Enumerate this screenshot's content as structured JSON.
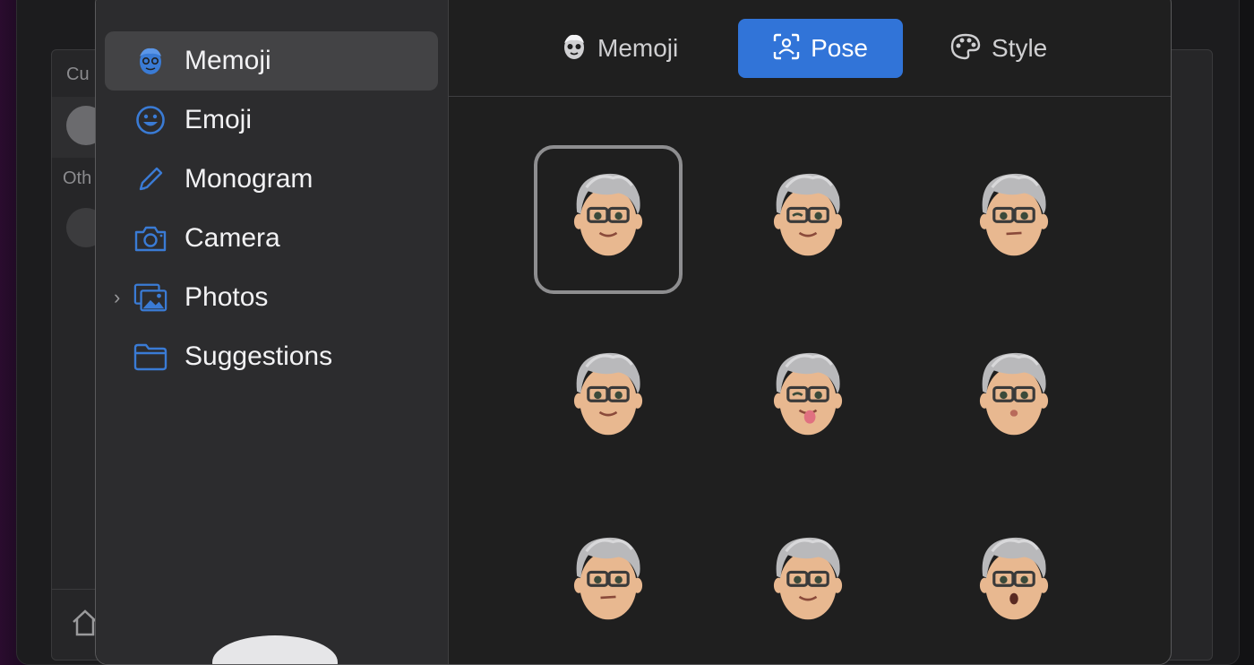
{
  "background": {
    "current_label": "Cu",
    "other_label": "Oth"
  },
  "sidebar": {
    "items": [
      {
        "label": "Memoji",
        "icon": "memoji-face-icon",
        "selected": true
      },
      {
        "label": "Emoji",
        "icon": "smiley-icon",
        "selected": false
      },
      {
        "label": "Monogram",
        "icon": "pencil-icon",
        "selected": false
      },
      {
        "label": "Camera",
        "icon": "camera-icon",
        "selected": false
      },
      {
        "label": "Photos",
        "icon": "photos-icon",
        "selected": false,
        "expandable": true
      },
      {
        "label": "Suggestions",
        "icon": "folder-icon",
        "selected": false
      }
    ]
  },
  "tabs": [
    {
      "label": "Memoji",
      "icon": "memoji-face-icon",
      "active": false
    },
    {
      "label": "Pose",
      "icon": "person-frame-icon",
      "active": true
    },
    {
      "label": "Style",
      "icon": "palette-icon",
      "active": false
    }
  ],
  "poses": [
    {
      "name": "smile",
      "selected": true
    },
    {
      "name": "wink",
      "selected": false
    },
    {
      "name": "neutral",
      "selected": false
    },
    {
      "name": "smirk",
      "selected": false
    },
    {
      "name": "tongue-out-wink",
      "selected": false
    },
    {
      "name": "kiss",
      "selected": false
    },
    {
      "name": "skeptical",
      "selected": false
    },
    {
      "name": "content",
      "selected": false
    },
    {
      "name": "surprised",
      "selected": false
    }
  ],
  "colors": {
    "accent": "#3174d8",
    "sidebar_icon": "#3a7bd5",
    "skin": "#e8b890",
    "hair": "#b9b9bb"
  }
}
